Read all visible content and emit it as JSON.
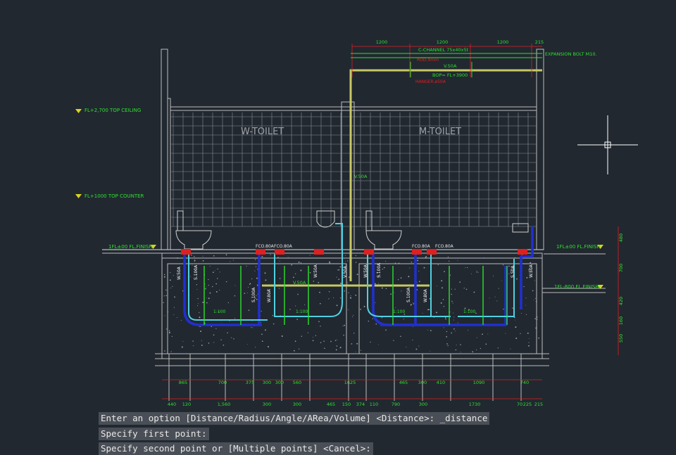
{
  "drawing": {
    "rooms": {
      "w_toilet": "W-TOILET",
      "m_toilet": "M-TOILET"
    },
    "levels": {
      "top_ceiling": "FL+2,700 TOP CEILING",
      "top_counter": "FL+1000 TOP COUNTER",
      "fl_finish_left": "1FL±00 FL.FINISH",
      "fl_finish_right": "1FL±00 FL.FINISH",
      "fl_800_finish": "1FL-800 FL.FINISH"
    },
    "annotations": {
      "c_channel": "C-CHANNEL 75x40x5t",
      "expansion_bolt": "EXPANSION BOLT M10.",
      "rod": "ROD.9mm",
      "vent_top": "V.50A",
      "bop": "BOP= FL+3900",
      "hanger": "HANGER.ø50A",
      "vent_riser": "V.50A",
      "fco_1": "FCO.80A",
      "fco_2": "FCO.80A",
      "fco_3": "FCO.80A",
      "fco_4": "FCO.80A",
      "vent_horizontal": "V.50A"
    },
    "pipe_labels": [
      "W.50A",
      "S.100A",
      "S.100A",
      "W.80A",
      "W.50A",
      "V.50A",
      "W.50A",
      "S.100A",
      "S.100A",
      "W.80A",
      "S.50A",
      "W.50A"
    ],
    "slopes": [
      "1:100",
      "1:100",
      "1:100",
      "1:100"
    ],
    "top_dims": [
      "1200",
      "1200",
      "1200",
      "215"
    ],
    "bottom_dims_1": [
      "865",
      "700",
      "375",
      "300",
      "300",
      "560",
      "1625",
      "465",
      "300",
      "410",
      "1090",
      "740"
    ],
    "bottom_dims_2": [
      "440",
      "120",
      "1,560",
      "300",
      "300",
      "465",
      "150",
      "374",
      "110",
      "790",
      "300",
      "1730",
      "70",
      "225",
      "215"
    ],
    "right_dims": [
      "480",
      "700",
      "420",
      "160",
      "550"
    ]
  },
  "command_line": {
    "line1": "Enter an option [Distance/Radius/Angle/ARea/Volume] <Distance>: _distance",
    "line2": "Specify first point:",
    "line3": "Specify second point or [Multiple points] <Cancel>:"
  },
  "colors": {
    "background": "#212830",
    "drawing_lines": "#c8c8c8",
    "annotation_green": "#2fe02f",
    "vent_yellow": "#c8c865",
    "drain_blue": "#2030d0",
    "water_cyan": "#50d0e0",
    "dimension_red": "#e02020",
    "level_marker": "#d6d620"
  }
}
